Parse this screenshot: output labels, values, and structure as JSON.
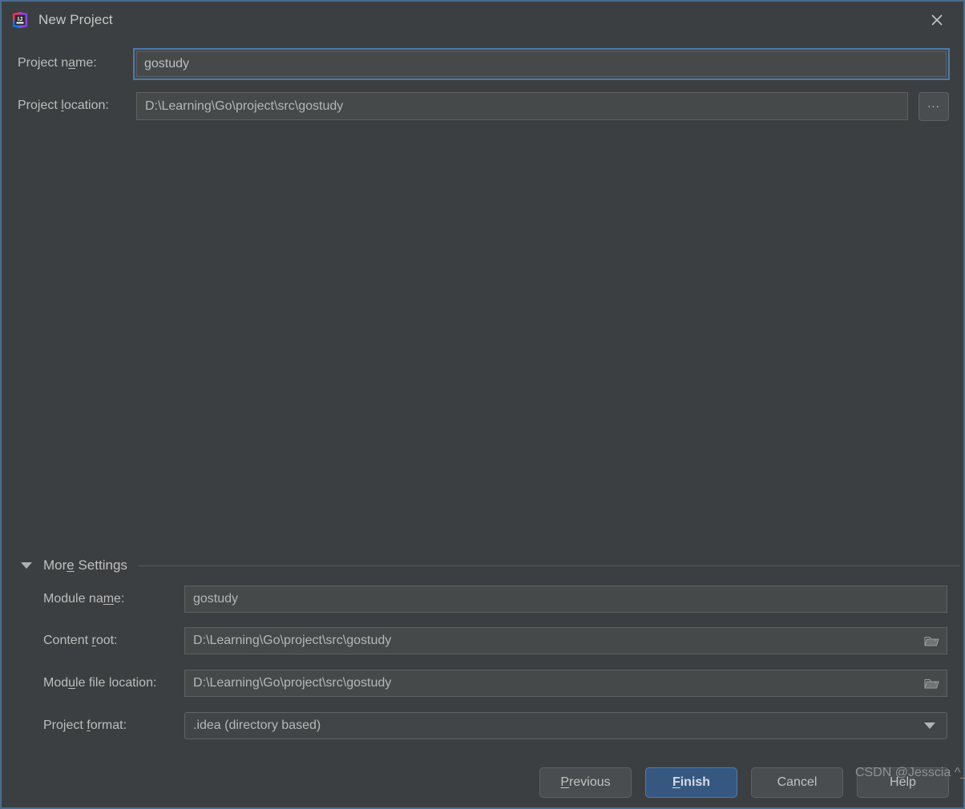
{
  "window": {
    "title": "New Project",
    "app_icon": "intellij-idea-icon",
    "close_icon": "close-icon",
    "accent_border": "#4a6d8c",
    "background": "#3c3f41"
  },
  "form": {
    "project_name": {
      "label_pre": "Project n",
      "label_mnemonic": "a",
      "label_post": "me:",
      "value": "gostudy",
      "focused": true
    },
    "project_location": {
      "label_pre": "Project ",
      "label_mnemonic": "l",
      "label_post": "ocation:",
      "value": "D:\\Learning\\Go\\project\\src\\gostudy",
      "browse_label": "...",
      "browse_icon": "ellipsis-icon"
    }
  },
  "more_settings": {
    "label_pre": "Mor",
    "label_mnemonic": "e",
    "label_post": " Settings",
    "expanded": true,
    "toggle_icon": "chevron-down-icon",
    "rows": [
      {
        "label_pre": "Module na",
        "label_mnemonic": "m",
        "label_post": "e:",
        "value": "gostudy",
        "has_browse": false,
        "type": "text"
      },
      {
        "label_pre": "Content ",
        "label_mnemonic": "r",
        "label_post": "oot:",
        "value": "D:\\Learning\\Go\\project\\src\\gostudy",
        "has_browse": true,
        "browse_icon": "folder-icon",
        "type": "text"
      },
      {
        "label_pre": "Mod",
        "label_mnemonic": "u",
        "label_post": "le file location:",
        "value": "D:\\Learning\\Go\\project\\src\\gostudy",
        "has_browse": true,
        "browse_icon": "folder-icon",
        "type": "text"
      },
      {
        "label_pre": "Project ",
        "label_mnemonic": "f",
        "label_post": "ormat:",
        "value": ".idea (directory based)",
        "has_browse": false,
        "dropdown_icon": "chevron-down-icon",
        "type": "select"
      }
    ]
  },
  "buttons": {
    "previous": {
      "pre": "",
      "mnemonic": "P",
      "post": "revious",
      "primary": false
    },
    "finish": {
      "pre": "",
      "mnemonic": "F",
      "post": "inish",
      "primary": true,
      "color": "#365880"
    },
    "cancel": {
      "pre": "Cancel",
      "mnemonic": "",
      "post": "",
      "primary": false
    },
    "help": {
      "pre": "Help",
      "mnemonic": "",
      "post": "",
      "primary": false
    }
  },
  "watermark": {
    "text": "CSDN @Jesscia ^_^"
  }
}
